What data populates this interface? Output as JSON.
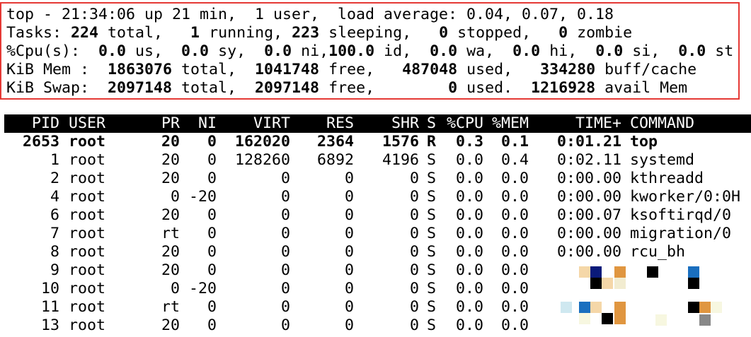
{
  "summary": {
    "line1": "top - 21:34:06 up 21 min,  1 user,  load average: 0.04, 0.07, 0.18",
    "tasks": {
      "label": "Tasks: ",
      "total": "224",
      "total_label": " total,   ",
      "running": "1",
      "running_label": " running, ",
      "sleeping": "223",
      "sleeping_label": " sleeping,   ",
      "stopped": "0",
      "stopped_label": " stopped,   ",
      "zombie": "0",
      "zombie_label": " zombie"
    },
    "cpu": {
      "label": "%Cpu(s):  ",
      "us": "0.0",
      "us_label": " us,  ",
      "sy": "0.0",
      "sy_label": " sy,  ",
      "ni": "0.0",
      "ni_label": " ni,",
      "id": "100.0",
      "id_label": " id,  ",
      "wa": "0.0",
      "wa_label": " wa,  ",
      "hi": "0.0",
      "hi_label": " hi,  ",
      "si": "0.0",
      "si_label": " si,  ",
      "st": "0.0",
      "st_label": " st"
    },
    "mem": {
      "label": "KiB Mem :  ",
      "total": "1863076",
      "total_label": " total,  ",
      "free": "1041748",
      "free_label": " free,   ",
      "used": "487048",
      "used_label": " used,   ",
      "buff": "334280",
      "buff_label": " buff/cache"
    },
    "swap": {
      "label": "KiB Swap:  ",
      "total": "2097148",
      "total_label": " total,  ",
      "free": "2097148",
      "free_label": " free,        ",
      "used": "0",
      "used_label": " used.  ",
      "avail": "1216928",
      "avail_label": " avail Mem"
    }
  },
  "table": {
    "columns": {
      "pid": "PID",
      "user": "USER",
      "pr": "PR",
      "ni": "NI",
      "virt": "VIRT",
      "res": "RES",
      "shr": "SHR",
      "s": "S",
      "cpu": "%CPU",
      "mem": "%MEM",
      "time": "TIME+",
      "cmd": "COMMAND"
    },
    "rows": [
      {
        "pid": "2653",
        "user": "root",
        "pr": "20",
        "ni": "0",
        "virt": "162020",
        "res": "2364",
        "shr": "1576",
        "s": "R",
        "cpu": "0.3",
        "mem": "0.1",
        "time": "0:01.21",
        "cmd": "top"
      },
      {
        "pid": "1",
        "user": "root",
        "pr": "20",
        "ni": "0",
        "virt": "128260",
        "res": "6892",
        "shr": "4196",
        "s": "S",
        "cpu": "0.0",
        "mem": "0.4",
        "time": "0:02.11",
        "cmd": "systemd"
      },
      {
        "pid": "2",
        "user": "root",
        "pr": "20",
        "ni": "0",
        "virt": "0",
        "res": "0",
        "shr": "0",
        "s": "S",
        "cpu": "0.0",
        "mem": "0.0",
        "time": "0:00.00",
        "cmd": "kthreadd"
      },
      {
        "pid": "4",
        "user": "root",
        "pr": "0",
        "ni": "-20",
        "virt": "0",
        "res": "0",
        "shr": "0",
        "s": "S",
        "cpu": "0.0",
        "mem": "0.0",
        "time": "0:00.00",
        "cmd": "kworker/0:0H"
      },
      {
        "pid": "6",
        "user": "root",
        "pr": "20",
        "ni": "0",
        "virt": "0",
        "res": "0",
        "shr": "0",
        "s": "S",
        "cpu": "0.0",
        "mem": "0.0",
        "time": "0:00.07",
        "cmd": "ksoftirqd/0"
      },
      {
        "pid": "7",
        "user": "root",
        "pr": "rt",
        "ni": "0",
        "virt": "0",
        "res": "0",
        "shr": "0",
        "s": "S",
        "cpu": "0.0",
        "mem": "0.0",
        "time": "0:00.00",
        "cmd": "migration/0"
      },
      {
        "pid": "8",
        "user": "root",
        "pr": "20",
        "ni": "0",
        "virt": "0",
        "res": "0",
        "shr": "0",
        "s": "S",
        "cpu": "0.0",
        "mem": "0.0",
        "time": "0:00.00",
        "cmd": "rcu_bh"
      },
      {
        "pid": "9",
        "user": "root",
        "pr": "20",
        "ni": "0",
        "virt": "0",
        "res": "0",
        "shr": "0",
        "s": "S",
        "cpu": "0.0",
        "mem": "0.0",
        "time": "",
        "cmd": ""
      },
      {
        "pid": "10",
        "user": "root",
        "pr": "0",
        "ni": "-20",
        "virt": "0",
        "res": "0",
        "shr": "0",
        "s": "S",
        "cpu": "0.0",
        "mem": "0.0",
        "time": "",
        "cmd": ""
      },
      {
        "pid": "11",
        "user": "root",
        "pr": "rt",
        "ni": "0",
        "virt": "0",
        "res": "0",
        "shr": "0",
        "s": "S",
        "cpu": "0.0",
        "mem": "0.0",
        "time": "",
        "cmd": ""
      },
      {
        "pid": "13",
        "user": "root",
        "pr": "20",
        "ni": "0",
        "virt": "0",
        "res": "0",
        "shr": "0",
        "s": "S",
        "cpu": "0.0",
        "mem": "0.0",
        "time": "",
        "cmd": ""
      }
    ]
  },
  "colors": {
    "summary_border": "#e53935",
    "header_bg": "#000000",
    "header_fg": "#ffffff",
    "redaction_palette": [
      "#f5d7a8",
      "#0a1a7a",
      "#e09640",
      "#000000",
      "#1a6fbf",
      "#f2ecd0",
      "#cfe8f0",
      "#f7f7e0",
      "#888888",
      "#2b6fb0"
    ]
  }
}
